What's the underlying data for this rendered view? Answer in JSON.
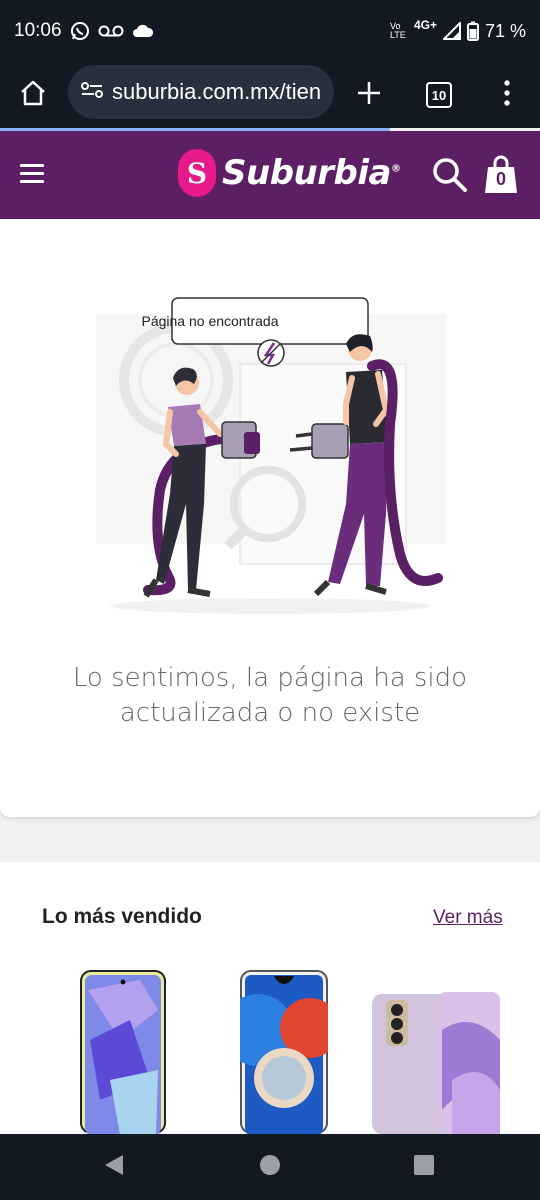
{
  "status_bar": {
    "time": "10:06",
    "network": "4G+",
    "volte": "Vo LTE",
    "battery": "71 %",
    "icons": [
      "whatsapp-icon",
      "voicemail-icon",
      "cloud-icon",
      "volte-icon",
      "signal-icon",
      "battery-icon"
    ]
  },
  "browser": {
    "url": "suburbia.com.mx/tien",
    "tab_count": "10",
    "icons": [
      "home-icon",
      "site-settings-icon",
      "new-tab-icon",
      "tabs-icon",
      "menu-dots-icon"
    ]
  },
  "header": {
    "logo_mark": "S",
    "logo_text": "Suburbia",
    "logo_reg": "®",
    "cart_count": "0",
    "brand_color": "#5c1f64",
    "logo_color": "#e8198a"
  },
  "error": {
    "bubble": "Página no encontrada",
    "message": "Lo sentimos, la página ha sido actualizada o no existe"
  },
  "bestsellers": {
    "title": "Lo más vendido",
    "more": "Ver más"
  }
}
